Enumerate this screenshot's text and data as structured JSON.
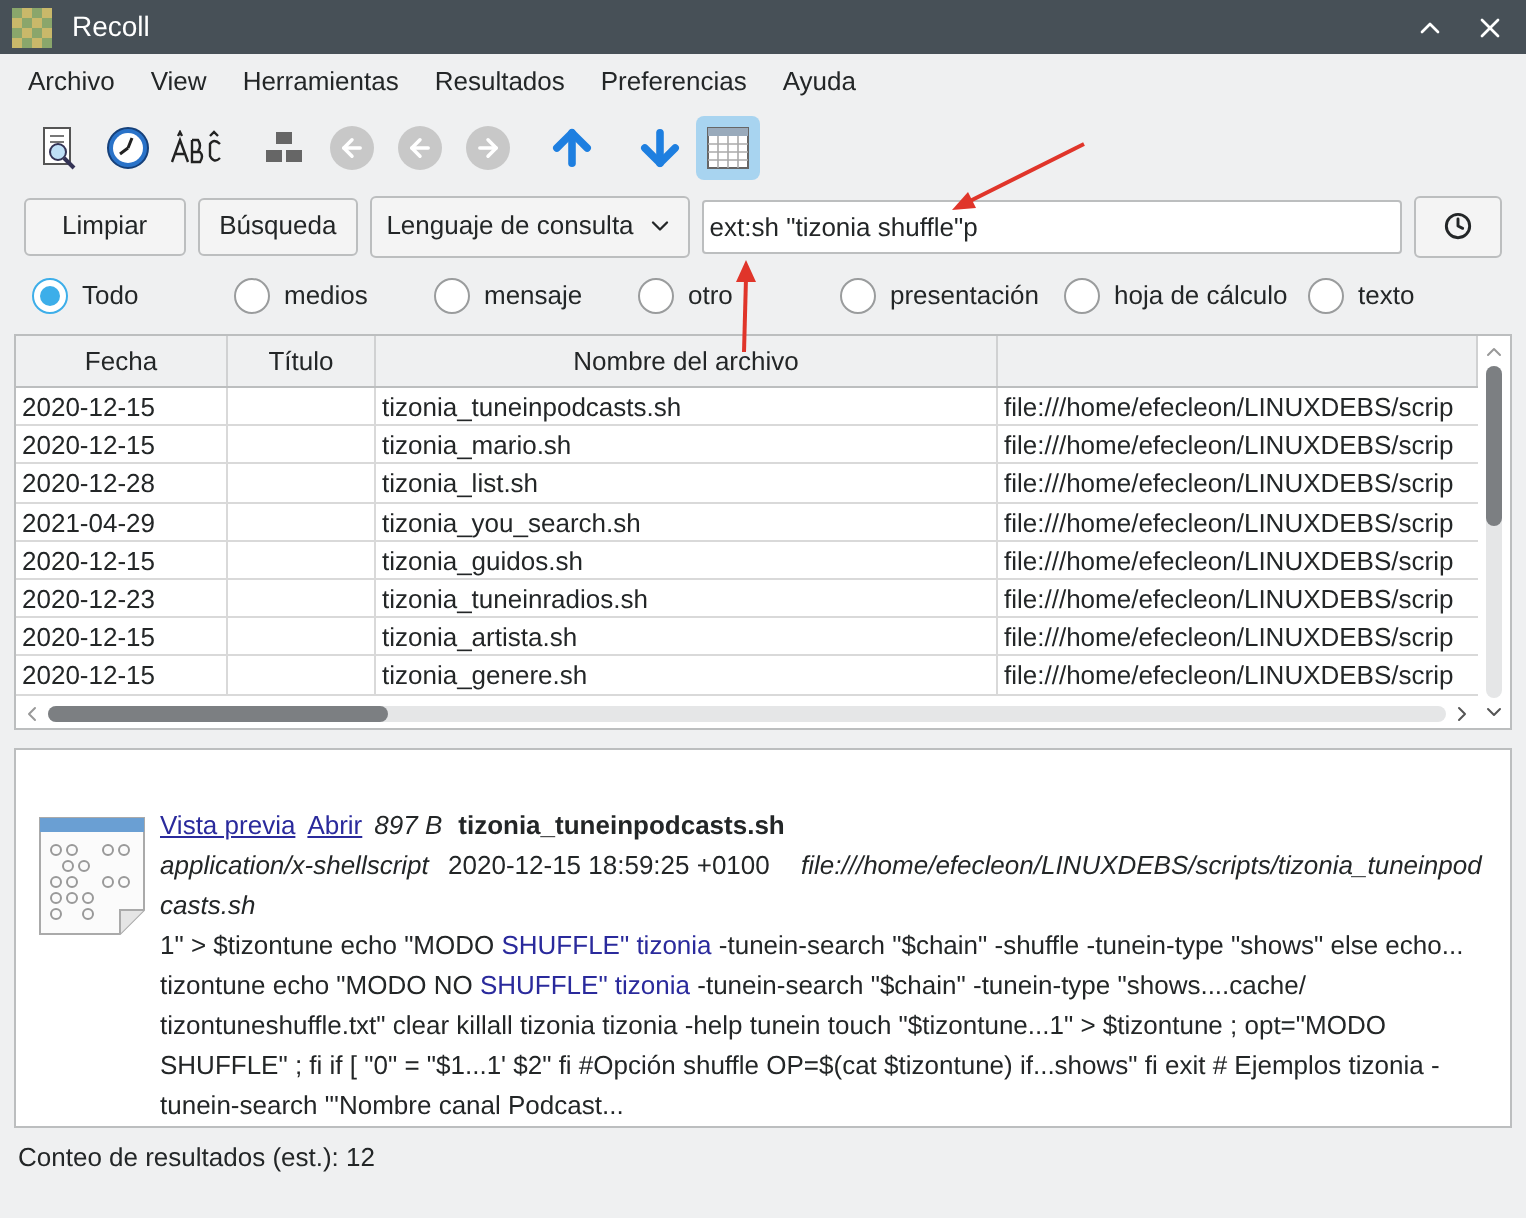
{
  "window": {
    "title": "Recoll"
  },
  "menu": [
    "Archivo",
    "View",
    "Herramientas",
    "Resultados",
    "Preferencias",
    "Ayuda"
  ],
  "toolbar": [
    {
      "kind": "query",
      "selected": false
    },
    {
      "kind": "history",
      "selected": false
    },
    {
      "kind": "spelling",
      "selected": false
    },
    {
      "kind": "index",
      "selected": false
    },
    {
      "kind": "first",
      "selected": false
    },
    {
      "kind": "back",
      "selected": false
    },
    {
      "kind": "forward",
      "selected": false
    },
    {
      "kind": "up",
      "selected": false
    },
    {
      "kind": "down",
      "selected": false
    },
    {
      "kind": "table",
      "selected": true
    }
  ],
  "search": {
    "clear_button": "Limpiar",
    "search_button": "Búsqueda",
    "mode": "Lenguaje de consulta",
    "value": "ext:sh \"tizonia shuffle\"p"
  },
  "filters": [
    {
      "label": "Todo",
      "selected": true
    },
    {
      "label": "medios",
      "selected": false
    },
    {
      "label": "mensaje",
      "selected": false
    },
    {
      "label": "otro",
      "selected": false
    },
    {
      "label": "presentación",
      "selected": false
    },
    {
      "label": "hoja de cálculo",
      "selected": false
    },
    {
      "label": "texto",
      "selected": false
    }
  ],
  "table": {
    "columns": [
      "Fecha",
      "Título",
      "Nombre del archivo"
    ],
    "rows": [
      {
        "fecha": "2020-12-15",
        "nombre": "tizonia_tuneinpodcasts.sh",
        "column_4": "file:///home/efecleon/LINUXDEBS/scrip"
      },
      {
        "fecha": "2020-12-15",
        "nombre": "tizonia_mario.sh",
        "column_4": "file:///home/efecleon/LINUXDEBS/scrip"
      },
      {
        "fecha": "2020-12-28",
        "nombre": "tizonia_list.sh",
        "column_4": "file:///home/efecleon/LINUXDEBS/scrip"
      },
      {
        "fecha": "2021-04-29",
        "nombre": "tizonia_you_search.sh",
        "column_4": "file:///home/efecleon/LINUXDEBS/scrip"
      },
      {
        "fecha": "2020-12-15",
        "nombre": "tizonia_guidos.sh",
        "column_4": "file:///home/efecleon/LINUXDEBS/scrip"
      },
      {
        "fecha": "2020-12-23",
        "nombre": "tizonia_tuneinradios.sh",
        "column_4": "file:///home/efecleon/LINUXDEBS/scrip"
      },
      {
        "fecha": "2020-12-15",
        "nombre": "tizonia_artista.sh",
        "column_4": "file:///home/efecleon/LINUXDEBS/scrip"
      },
      {
        "fecha": "2020-12-15",
        "nombre": "tizonia_genere.sh",
        "column_4": "file:///home/efecleon/LINUXDEBS/scrip"
      }
    ]
  },
  "preview": {
    "preview_link": "Vista previa",
    "open_link": "Abrir",
    "size": "897 B",
    "filename": "tizonia_tuneinpodcasts.sh",
    "mimetype": "application/x-shellscript",
    "date": "2020-12-15 18:59:25 +0100",
    "path": "file:///home/efecleon/LINUXDEBS/scripts/tizonia_tuneinpodcasts.sh",
    "snippet": [
      {
        "text": "1\" > $tizontune echo \"MODO ",
        "highlighted": false
      },
      {
        "text": "SHUFFLE\" tizonia",
        "highlighted": true
      },
      {
        "text": " -tunein-search \"$chain\" -shuffle -tunein-type \"shows\" else echo... tizontune echo \"MODO NO ",
        "highlighted": false
      },
      {
        "text": "SHUFFLE\" tizonia",
        "highlighted": true
      },
      {
        "text": " -tunein-search \"$chain\" -tunein-type \"shows....cache/ tizontuneshuffle.txt\" clear killall tizonia tizonia -help tunein touch \"$tizontune...1\" > $tizontune ; opt=\"MODO SHUFFLE\" ; fi if [ \"0\" = \"$1...1' $2\" fi #Opción shuffle OP=$(cat $tizontune) if...shows\" fi exit # Ejemplos tizonia -tunein-search \"'Nombre canal Podcast...",
        "highlighted": false
      }
    ]
  },
  "status_bar": "Conteo de resultados (est.): 12"
}
